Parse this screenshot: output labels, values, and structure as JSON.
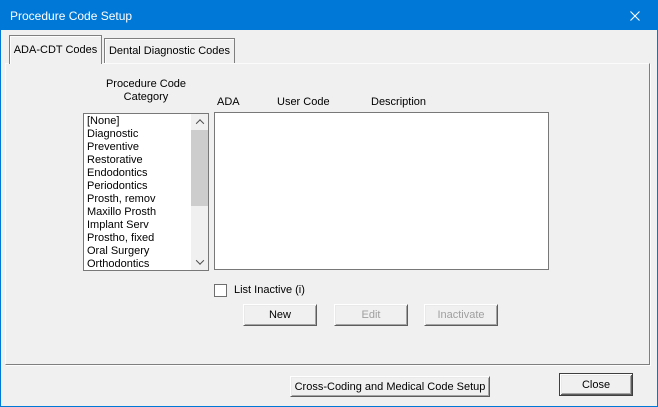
{
  "window": {
    "title": "Procedure Code Setup"
  },
  "colors": {
    "titlebar": "#0078d7",
    "accent_border": "#0078d7",
    "dialog_bg": "#f0f0f0",
    "disabled_text": "#9f9f9f"
  },
  "tabs": [
    {
      "label": "ADA-CDT Codes",
      "active": true
    },
    {
      "label": "Dental Diagnostic Codes",
      "active": false
    }
  ],
  "category": {
    "label_line1": "Procedure Code",
    "label_line2": "Category",
    "items": [
      "[None]",
      "Diagnostic",
      "Preventive",
      "Restorative",
      "Endodontics",
      "Periodontics",
      "Prosth, remov",
      "Maxillo Prosth",
      "Implant Serv",
      "Prostho, fixed",
      "Oral Surgery",
      "Orthodontics"
    ]
  },
  "codes": {
    "headers": [
      "ADA",
      "User Code",
      "Description"
    ],
    "rows": []
  },
  "options": {
    "list_inactive_label": "List Inactive (i)",
    "list_inactive_checked": false
  },
  "actions": {
    "new": "New",
    "edit": "Edit",
    "inactivate": "Inactivate",
    "edit_enabled": false,
    "inactivate_enabled": false
  },
  "footer": {
    "cross_coding": "Cross-Coding and Medical Code Setup",
    "close": "Close"
  }
}
